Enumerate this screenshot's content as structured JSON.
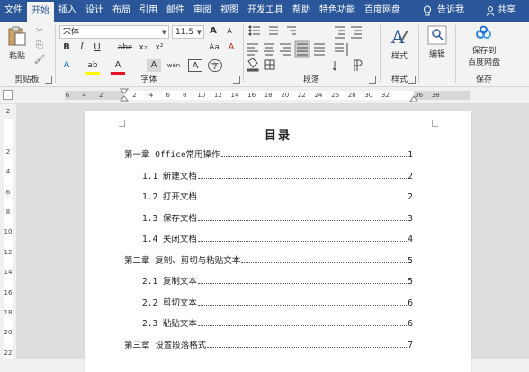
{
  "tabs": [
    "文件",
    "开始",
    "插入",
    "设计",
    "布局",
    "引用",
    "邮件",
    "审阅",
    "视图",
    "开发工具",
    "帮助",
    "特色功能",
    "百度网盘"
  ],
  "active_tab": "开始",
  "tell_me": "告诉我",
  "share": "共享",
  "clipboard": {
    "paste_label": "粘贴",
    "group_label": "剪贴板"
  },
  "font": {
    "name": "宋体",
    "size": "11.5",
    "group_label": "字体",
    "bold": "B",
    "italic": "I",
    "underline": "U",
    "strike": "abc",
    "subscript": "x₂",
    "superscript": "x²",
    "font_color_glyph": "A",
    "highlight_glyph": "ab",
    "grow": "A",
    "shrink": "A",
    "case": "Aa",
    "clear": "A",
    "phonetic": "wén",
    "border_char": "A",
    "char_shade": "A",
    "enclose": "字"
  },
  "paragraph": {
    "group_label": "段落"
  },
  "styles": {
    "label": "样式",
    "group_label": "样式"
  },
  "editing": {
    "label": "编辑"
  },
  "save": {
    "line1": "保存到",
    "line2": "百度网盘",
    "group_label": "保存"
  },
  "ruler": {
    "h_numbers": [
      "6",
      "4",
      "2",
      "",
      "2",
      "4",
      "6",
      "8",
      "10",
      "12",
      "14",
      "16",
      "18",
      "20",
      "22",
      "24",
      "26",
      "28",
      "30",
      "32",
      "",
      "36",
      "38"
    ],
    "v_numbers": [
      "2",
      "",
      "2",
      "4",
      "6",
      "8",
      "10",
      "12",
      "14",
      "16",
      "18",
      "20",
      "22"
    ]
  },
  "document": {
    "title": "目录",
    "entries": [
      {
        "text": "第一章 Office常用操作",
        "page": "1",
        "level": 1
      },
      {
        "text": "1.1 新建文档",
        "page": "2",
        "level": 2
      },
      {
        "text": "1.2 打开文档",
        "page": "2",
        "level": 2
      },
      {
        "text": "1.3 保存文档",
        "page": "3",
        "level": 2
      },
      {
        "text": "1.4 关闭文档",
        "page": "4",
        "level": 2
      },
      {
        "text": "第二章 复制、剪切与粘贴文本",
        "page": "5",
        "level": 1
      },
      {
        "text": "2.1 复制文本",
        "page": "5",
        "level": 2
      },
      {
        "text": "2.2 剪切文本",
        "page": "6",
        "level": 2
      },
      {
        "text": "2.3 粘贴文本",
        "page": "6",
        "level": 2
      },
      {
        "text": "第三章 设置段落格式",
        "page": "7",
        "level": 1
      }
    ]
  },
  "colors": {
    "tab_bar": "#2b579a",
    "ribbon": "#f3f3f3",
    "font_color": "#e81123",
    "highlight": "#ffff00"
  }
}
